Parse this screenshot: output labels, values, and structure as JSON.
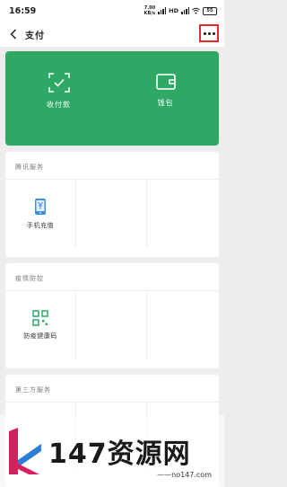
{
  "status_bar": {
    "time": "16:59",
    "speed_value": "7.00",
    "speed_unit": "KB/s",
    "hd_label": "HD",
    "battery": "55"
  },
  "header": {
    "title": "支付",
    "back_icon": "chevron-left-icon",
    "more_icon": "more-dots-icon"
  },
  "pay_panel": {
    "color": "#2fa866",
    "items": [
      {
        "label": "收付款",
        "icon": "scan-check-icon"
      },
      {
        "label": "钱包",
        "icon": "wallet-icon"
      }
    ]
  },
  "sections": [
    {
      "title": "腾讯服务",
      "items": [
        {
          "label": "手机充值",
          "icon": "phone-yuan-icon"
        }
      ]
    },
    {
      "title": "疫情防控",
      "items": [
        {
          "label": "防疫健康码",
          "icon": "qr-code-icon"
        }
      ]
    },
    {
      "title": "第三方服务",
      "items": []
    }
  ],
  "watermark": {
    "text": "147资源网",
    "url": "——no147.com"
  },
  "colors": {
    "accent": "#2fa866",
    "highlight": "#e02c2c"
  }
}
